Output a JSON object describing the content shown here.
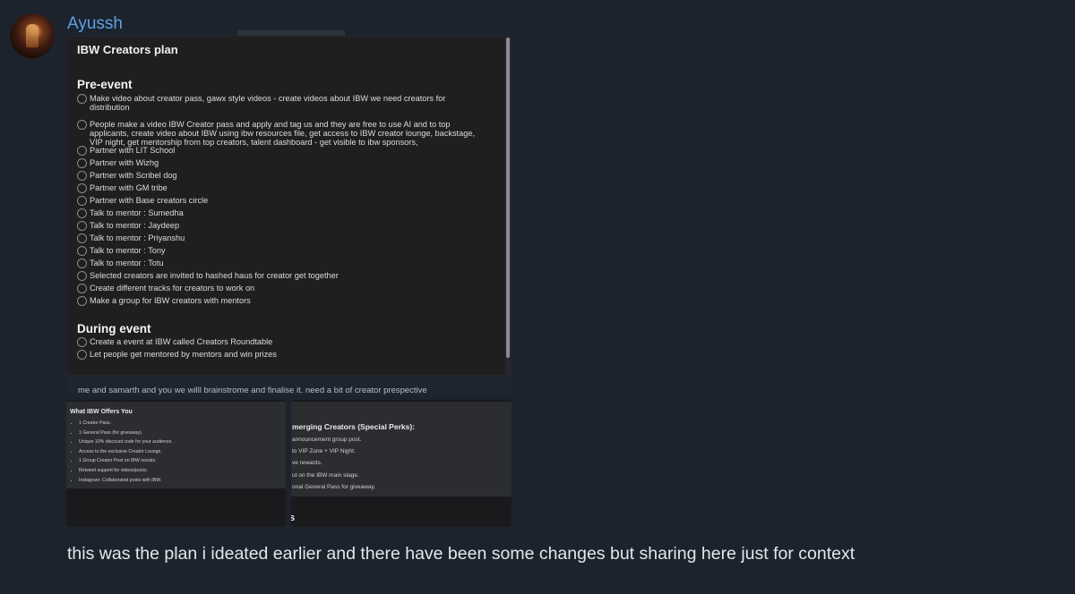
{
  "chat": {
    "sender": "Ayussh",
    "message": "this was the plan i ideated earlier and there have been some changes but sharing here just for context"
  },
  "note": {
    "title": "IBW Creators plan",
    "sections": [
      {
        "heading": "Pre-event",
        "items": [
          "Make video about creator pass, gawx style videos - create videos about IBW we need creators for distribution",
          "People make a video IBW Creator pass and apply and tag us and they are free to use AI and to top applicants, create video about IBW using ibw resources file, get access to IBW creator lounge, backstage, VIP night, get mentorship from top creators, talent dashboard - get visible to ibw sponsors,",
          "Partner with LIT School",
          "Partner with Wizhg",
          "Partner with Scribel dog",
          "Partner with GM tribe",
          "Partner with Base creators circle",
          "Talk to mentor : Sumedha",
          "Talk to mentor : Jaydeep",
          "Talk to mentor : Priyanshu",
          "Talk to mentor : Tony",
          "Talk to mentor : Totu",
          "Selected creators are invited to hashed haus for creator get together",
          "Create different tracks for creators to work on",
          "Make a group for IBW creators with mentors"
        ]
      },
      {
        "heading": "During event",
        "items": [
          "Create a event at IBW called Creators Roundtable",
          "Let people get mentored by mentors and win prizes"
        ]
      }
    ],
    "caption": "me and samarth and you we willl brainstrome and finalise it. need a bit of creator prespective"
  },
  "image1": {
    "heading": "What IBW Offers You",
    "bullets": [
      "1 Creator Pass.",
      "1 General Pass (for giveaway).",
      "Unique 10% discount code for your audience.",
      "Access to the exclusive Creator Lounge.",
      "1 Group Creator Post on IBW socials.",
      "Retweet support for videos/posts.",
      "Instagram: Collaborated posts with IBW."
    ]
  },
  "image2": {
    "heading": "merging Creators (Special Perks):",
    "lines": [
      "announcement group post.",
      "to VIP Zone + VIP Night.",
      "ve rewards.",
      "ut on the IBW main stage.",
      "onal General Pass for giveaway."
    ],
    "bottom_text": "s"
  }
}
